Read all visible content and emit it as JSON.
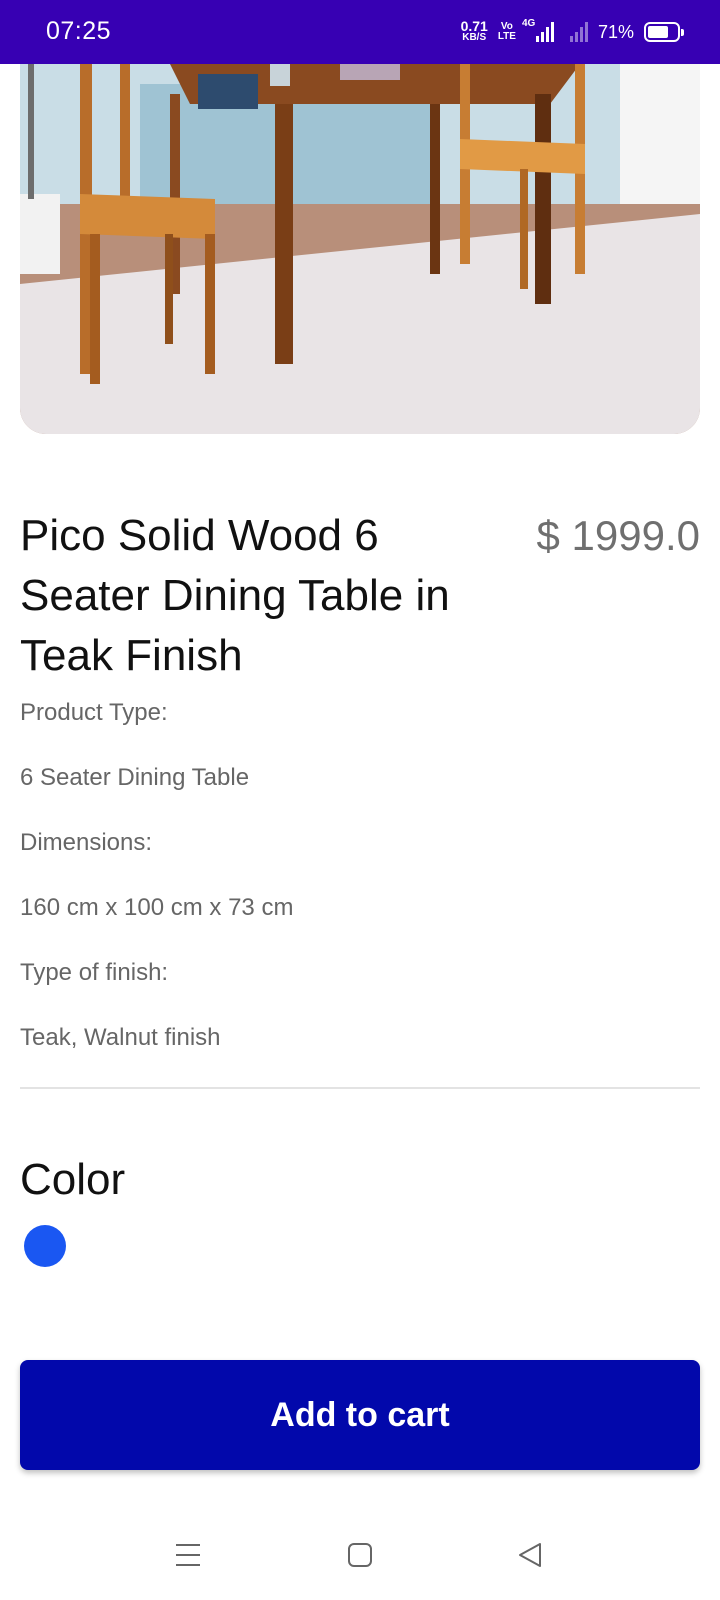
{
  "status_bar": {
    "time": "07:25",
    "net_speed_value": "0.71",
    "net_speed_unit": "KB/S",
    "volte_top": "Vo",
    "volte_bottom": "LTE",
    "network_type": "4G",
    "battery_percent": "71%",
    "battery_level": 0.71
  },
  "product": {
    "title": "Pico Solid Wood 6 Seater Dining Table in Teak Finish",
    "price": "$ 1999.0",
    "specs": [
      "Product Type:",
      "6 Seater Dining Table",
      "Dimensions:",
      "160 cm x 100 cm x 73 cm",
      "Type of finish:",
      "Teak, Walnut finish"
    ],
    "color_label": "Color",
    "selected_color": "#1a57f2"
  },
  "actions": {
    "add_to_cart_label": "Add to cart"
  },
  "nav_bar": {
    "icons": [
      "menu-icon",
      "home-square-icon",
      "back-triangle-icon"
    ]
  },
  "colors": {
    "status_bar": "#3700b3",
    "primary_button": "#0208ab",
    "price_text": "#6f6f6f"
  }
}
